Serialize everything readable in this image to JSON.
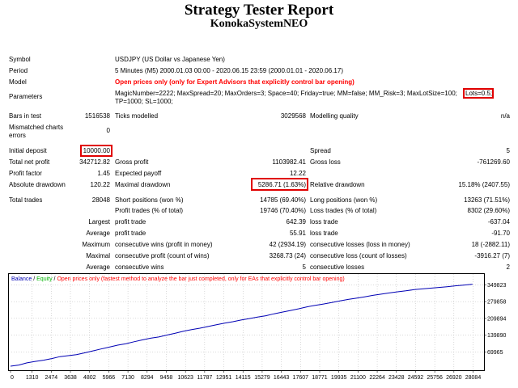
{
  "report": {
    "title": "Strategy Tester Report",
    "subtitle": "KonokaSystemNEO"
  },
  "settings": {
    "symbol_label": "Symbol",
    "symbol_value": "USDJPY (US Dollar vs Japanese Yen)",
    "period_label": "Period",
    "period_value": "5 Minutes (M5) 2000.01.03 00:00 - 2020.06.15 23:59 (2000.01.01 - 2020.06.17)",
    "model_label": "Model",
    "model_value": "Open prices only (only for Expert Advisors that explicitly control bar opening)",
    "parameters_label": "Parameters",
    "parameters_line1": "MagicNumber=2222; MaxSpread=20; MaxOrders=3; Space=40; Friday=true; MM=false; MM_Risk=3; MaxLotSize=100;",
    "parameters_lots": "Lots=0.5;",
    "parameters_line2": "TP=1000; SL=1000;"
  },
  "stats": {
    "bars_in_test_label": "Bars in test",
    "bars_in_test": "1516538",
    "ticks_modelled_label": "Ticks modelled",
    "ticks_modelled": "3029568",
    "modelling_quality_label": "Modelling quality",
    "modelling_quality": "n/a",
    "mismatched_label_1": "Mismatched charts",
    "mismatched_label_2": "errors",
    "mismatched": "0",
    "initial_deposit_label": "Initial deposit",
    "initial_deposit": "10000.00",
    "spread_label": "Spread",
    "spread": "5",
    "total_net_profit_label": "Total net profit",
    "total_net_profit": "342712.82",
    "gross_profit_label": "Gross profit",
    "gross_profit": "1103982.41",
    "gross_loss_label": "Gross loss",
    "gross_loss": "-761269.60",
    "profit_factor_label": "Profit factor",
    "profit_factor": "1.45",
    "expected_payoff_label": "Expected payoff",
    "expected_payoff": "12.22",
    "absolute_drawdown_label": "Absolute drawdown",
    "absolute_drawdown": "120.22",
    "maximal_drawdown_label": "Maximal drawdown",
    "maximal_drawdown": "5286.71 (1.63%)",
    "relative_drawdown_label": "Relative drawdown",
    "relative_drawdown": "15.18% (2407.55)",
    "total_trades_label": "Total trades",
    "total_trades": "28048",
    "short_positions_label": "Short positions (won %)",
    "short_positions": "14785 (69.40%)",
    "long_positions_label": "Long positions (won %)",
    "long_positions": "13263 (71.51%)",
    "profit_trades_label": "Profit trades (% of total)",
    "profit_trades": "19746 (70.40%)",
    "loss_trades_label": "Loss trades (% of total)",
    "loss_trades": "8302 (29.60%)",
    "largest_label": "Largest",
    "largest_profit_label": "profit trade",
    "largest_profit": "642.39",
    "largest_loss_label": "loss trade",
    "largest_loss": "-637.04",
    "average_label": "Average",
    "average_profit_label": "profit trade",
    "average_profit": "55.91",
    "average_loss_label": "loss trade",
    "average_loss": "-91.70",
    "maximum_label": "Maximum",
    "max_consec_wins_label": "consecutive wins (profit in money)",
    "max_consec_wins": "42 (2934.19)",
    "max_consec_losses_label": "consecutive losses (loss in money)",
    "max_consec_losses": "18 (-2882.11)",
    "maximal_label": "Maximal",
    "maximal_consec_profit_label": "consecutive profit (count of wins)",
    "maximal_consec_profit": "3268.73 (24)",
    "maximal_consec_loss_label": "consecutive loss (count of losses)",
    "maximal_consec_loss": "-3916.27 (7)",
    "average2_label": "Average",
    "avg_consec_wins_label": "consecutive wins",
    "avg_consec_wins": "5",
    "avg_consec_losses_label": "consecutive losses",
    "avg_consec_losses": "2"
  },
  "chart_data": {
    "type": "line",
    "legend_balance": "Balance",
    "legend_sep1": " / ",
    "legend_equity": "Equity",
    "legend_sep2": " / ",
    "legend_note": "Open prices only (fastest method to analyze the bar just completed, only for EAs that explicitly control bar opening)",
    "colors": {
      "balance": "#0000b4",
      "equity": "#00b400",
      "note": "#ff0000",
      "grid": "#b4b4b4"
    },
    "grid": true,
    "xlim": [
      0,
      28600
    ],
    "ylim": [
      0,
      358000
    ],
    "x_ticks": [
      0,
      1310,
      2474,
      3638,
      4802,
      5966,
      7130,
      8294,
      9458,
      10623,
      11787,
      12951,
      14115,
      15279,
      16443,
      17607,
      18771,
      19935,
      21100,
      22264,
      23428,
      24592,
      25756,
      26920,
      28084
    ],
    "y_ticks": [
      69965,
      139890,
      209894,
      279858,
      349823
    ],
    "series": [
      {
        "x": [
          0,
          500,
          1000,
          1500,
          2000,
          2500,
          3000,
          3500,
          4000,
          4500,
          5000,
          5500,
          6000,
          6500,
          7000,
          7500,
          8000,
          8500,
          9000,
          9500,
          10000,
          10500,
          11000,
          11500,
          12000,
          12500,
          13000,
          13500,
          14000,
          14500,
          15000,
          15500,
          16000,
          16500,
          17000,
          17500,
          18000,
          18500,
          19000,
          19500,
          20000,
          20500,
          21000,
          21500,
          22000,
          22500,
          23000,
          23500,
          24000,
          24500,
          25000,
          25500,
          26000,
          26500,
          27000,
          27500,
          28048
        ],
        "y": [
          10000,
          15000,
          24000,
          30000,
          35000,
          42000,
          50000,
          54000,
          58000,
          66000,
          74000,
          82000,
          90000,
          98000,
          104000,
          112000,
          120000,
          127000,
          132000,
          140000,
          148000,
          156000,
          163000,
          169000,
          176000,
          183000,
          190000,
          196000,
          203000,
          209000,
          215000,
          221000,
          229000,
          236000,
          243000,
          250000,
          258000,
          264000,
          270000,
          276000,
          283000,
          289000,
          294000,
          300000,
          306000,
          311000,
          316000,
          321000,
          325000,
          330000,
          333000,
          336000,
          339000,
          342000,
          346000,
          349000,
          352700
        ]
      }
    ]
  }
}
